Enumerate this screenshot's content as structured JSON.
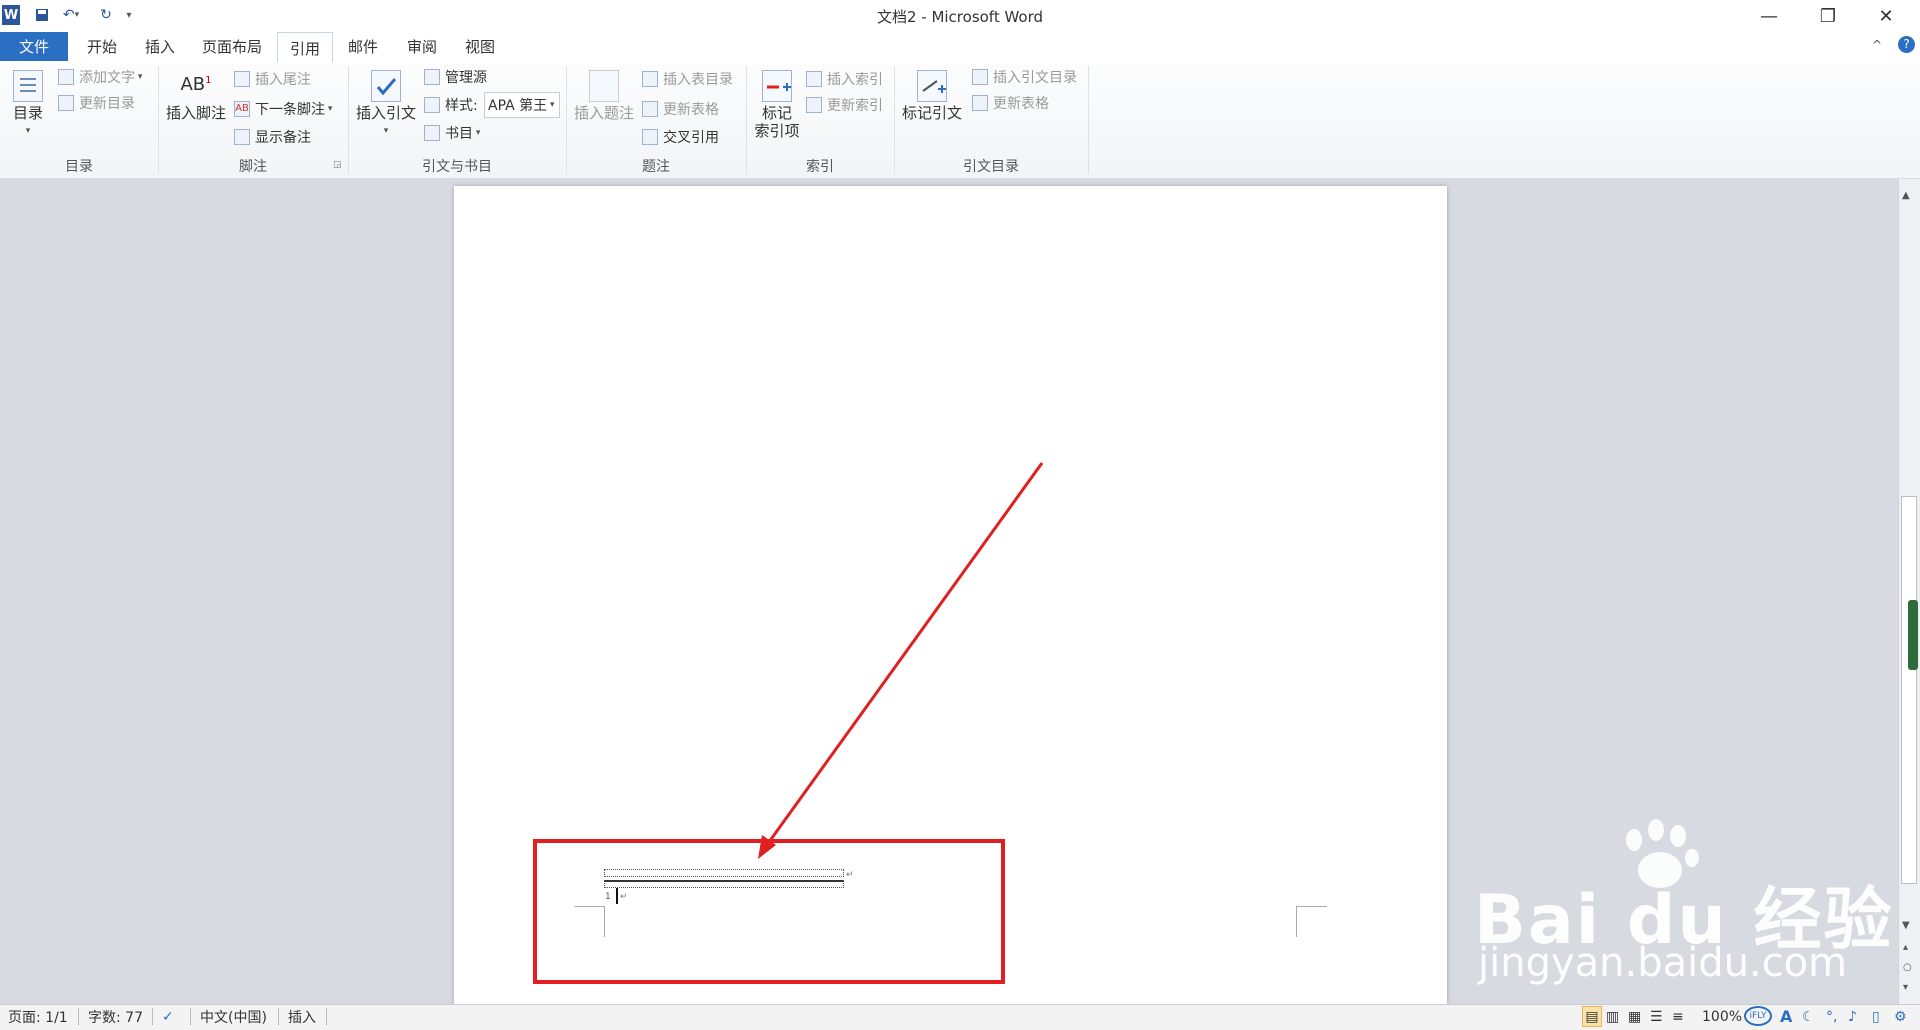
{
  "window": {
    "title": "文档2 - Microsoft Word"
  },
  "quick_access": {
    "word_logo": "W",
    "save_icon": "save-icon",
    "undo_icon": "undo-icon",
    "redo_icon": "redo-icon",
    "customize_icon": "customize-icon"
  },
  "window_controls": {
    "minimize": "—",
    "restore": "❐",
    "close": "✕"
  },
  "tabs": [
    {
      "label": "文件"
    },
    {
      "label": "开始"
    },
    {
      "label": "插入"
    },
    {
      "label": "页面布局"
    },
    {
      "label": "引用"
    },
    {
      "label": "邮件"
    },
    {
      "label": "审阅"
    },
    {
      "label": "视图"
    }
  ],
  "active_tab": "引用",
  "ribbon": {
    "toc": {
      "big": "目录",
      "add_text": "添加文字",
      "update_toc": "更新目录",
      "group": "目录"
    },
    "footnote": {
      "big": "插入脚注",
      "insert_endnote": "插入尾注",
      "next_footnote": "下一条脚注",
      "show_notes": "显示备注",
      "group": "脚注"
    },
    "citation": {
      "big": "插入引文",
      "manage_sources": "管理源",
      "style_label": "样式:",
      "style_value": "APA 第王",
      "bibliography": "书目",
      "group": "引文与书目"
    },
    "caption": {
      "big": "插入题注",
      "insert_tof": "插入表目录",
      "update_table": "更新表格",
      "cross_ref": "交叉引用",
      "group": "题注"
    },
    "index": {
      "big_line1": "标记",
      "big_line2": "索引项",
      "insert_index": "插入索引",
      "update_index": "更新索引",
      "group": "索引"
    },
    "toa": {
      "big": "标记引文",
      "insert_toa": "插入引文目录",
      "update_table": "更新表格",
      "group": "引文目录"
    },
    "minimize_icon": "^",
    "help_icon": "?"
  },
  "document": {
    "annotation_color": "#e02020",
    "para_mark": "↵"
  },
  "status": {
    "page": "页面: 1/1",
    "words": "字数: 77",
    "lang": "中文(中国)",
    "mode": "插入",
    "zoom": "100%",
    "ime": "iFLY",
    "ime_letter": "A"
  },
  "watermark": {
    "brand": "Bai du 经验",
    "url": "jingyan.baidu.com"
  }
}
